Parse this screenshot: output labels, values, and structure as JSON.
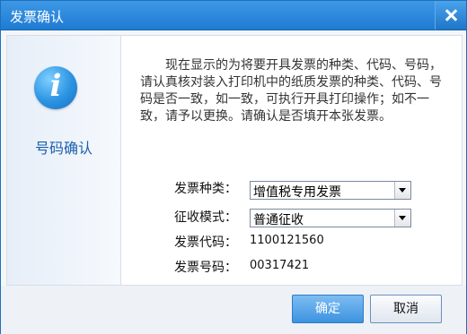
{
  "window": {
    "title": "发票确认",
    "close_icon": "close-icon"
  },
  "sidebar": {
    "icon": "info-icon",
    "icon_glyph": "i",
    "label": "号码确认"
  },
  "message": "现在显示的为将要开具发票的种类、代码、号码，请认真核对装入打印机中的纸质发票的种类、代码、号码是否一致，如一致，可执行开具打印操作；如不一致，请予以更换。请确认是否填开本张发票。",
  "form": {
    "invoice_type_label": "发票种类：",
    "invoice_type_value": "增值税专用发票",
    "collection_mode_label": "征收模式：",
    "collection_mode_value": "普通征收",
    "invoice_code_label": "发票代码：",
    "invoice_code_value": "1100121560",
    "invoice_number_label": "发票号码：",
    "invoice_number_value": "00317421"
  },
  "buttons": {
    "ok": "确定",
    "cancel": "取消"
  },
  "colors": {
    "titlebar": "#1f7bd3",
    "accent": "#2a93e2",
    "sidebar_label": "#1b5fae"
  }
}
